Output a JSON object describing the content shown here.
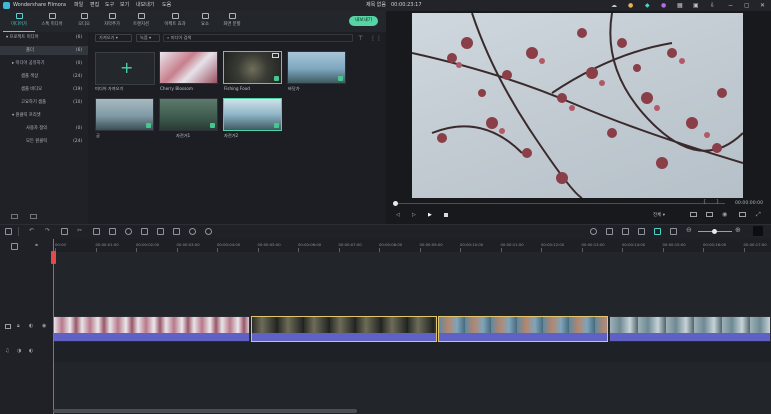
{
  "app": {
    "title": "Wondershare Filmora",
    "menu": [
      "파일",
      "편집",
      "도구",
      "보기",
      "내보내기",
      "도움"
    ],
    "project_title": "제목 없음",
    "project_time": "00:00:23:17"
  },
  "toolbar": {
    "items": [
      {
        "label": "미디어가"
      },
      {
        "label": "스톡 미디어"
      },
      {
        "label": "오디오"
      },
      {
        "label": "자막추가"
      },
      {
        "label": "트랜지션"
      },
      {
        "label": "이펙트 효과"
      },
      {
        "label": "요소"
      },
      {
        "label": "화면 분할"
      }
    ],
    "export_label": "내보내기"
  },
  "sidebar": {
    "rows": [
      {
        "label": "▾ 프로젝트 미디어",
        "count": "(6)"
      },
      {
        "label": "폴더",
        "count": "(6)"
      },
      {
        "label": "▸ 미디어 공유하기",
        "count": "(0)"
      },
      {
        "label": "샘플 색상",
        "count": "(24)"
      },
      {
        "label": "샘플 비디오",
        "count": "(19)"
      },
      {
        "label": "고요하기 샘플",
        "count": "(10)"
      },
      {
        "label": "▾ 원클릭 프리셋",
        "count": ""
      },
      {
        "label": "사용자 정의",
        "count": "(0)"
      },
      {
        "label": "모든 원클릭",
        "count": "(24)"
      }
    ]
  },
  "media": {
    "filter1": "가져오기",
    "filter2": "녹음",
    "search_placeholder": "미디어 검색",
    "import_caption": "미디어 가져오기",
    "items": [
      {
        "caption": "Cherry Blossom"
      },
      {
        "caption": "Fishing Food"
      },
      {
        "caption": "바닷가"
      },
      {
        "caption": "궁"
      },
      {
        "caption": "자전거1"
      },
      {
        "caption": "자전거2"
      }
    ]
  },
  "preview": {
    "timecode": "00:00:00:00",
    "quality": "전체"
  },
  "timeline": {
    "ticks": [
      "00:00",
      "00:00:01:00",
      "00:00:02:00",
      "00:00:03:00",
      "00:00:04:00",
      "00:00:05:00",
      "00:00:06:00",
      "00:00:07:00",
      "00:00:08:00",
      "00:00:09:00",
      "00:00:10:00",
      "00:00:11:00",
      "00:00:12:00",
      "00:00:13:00",
      "00:00:14:00",
      "00:00:15:00",
      "00:00:16:00",
      "00:00:17:00"
    ]
  },
  "colors": {
    "accent": "#4fd1c5",
    "export": "#56d4a5",
    "playhead": "#e44a4a",
    "audio": "#5f62c4"
  }
}
